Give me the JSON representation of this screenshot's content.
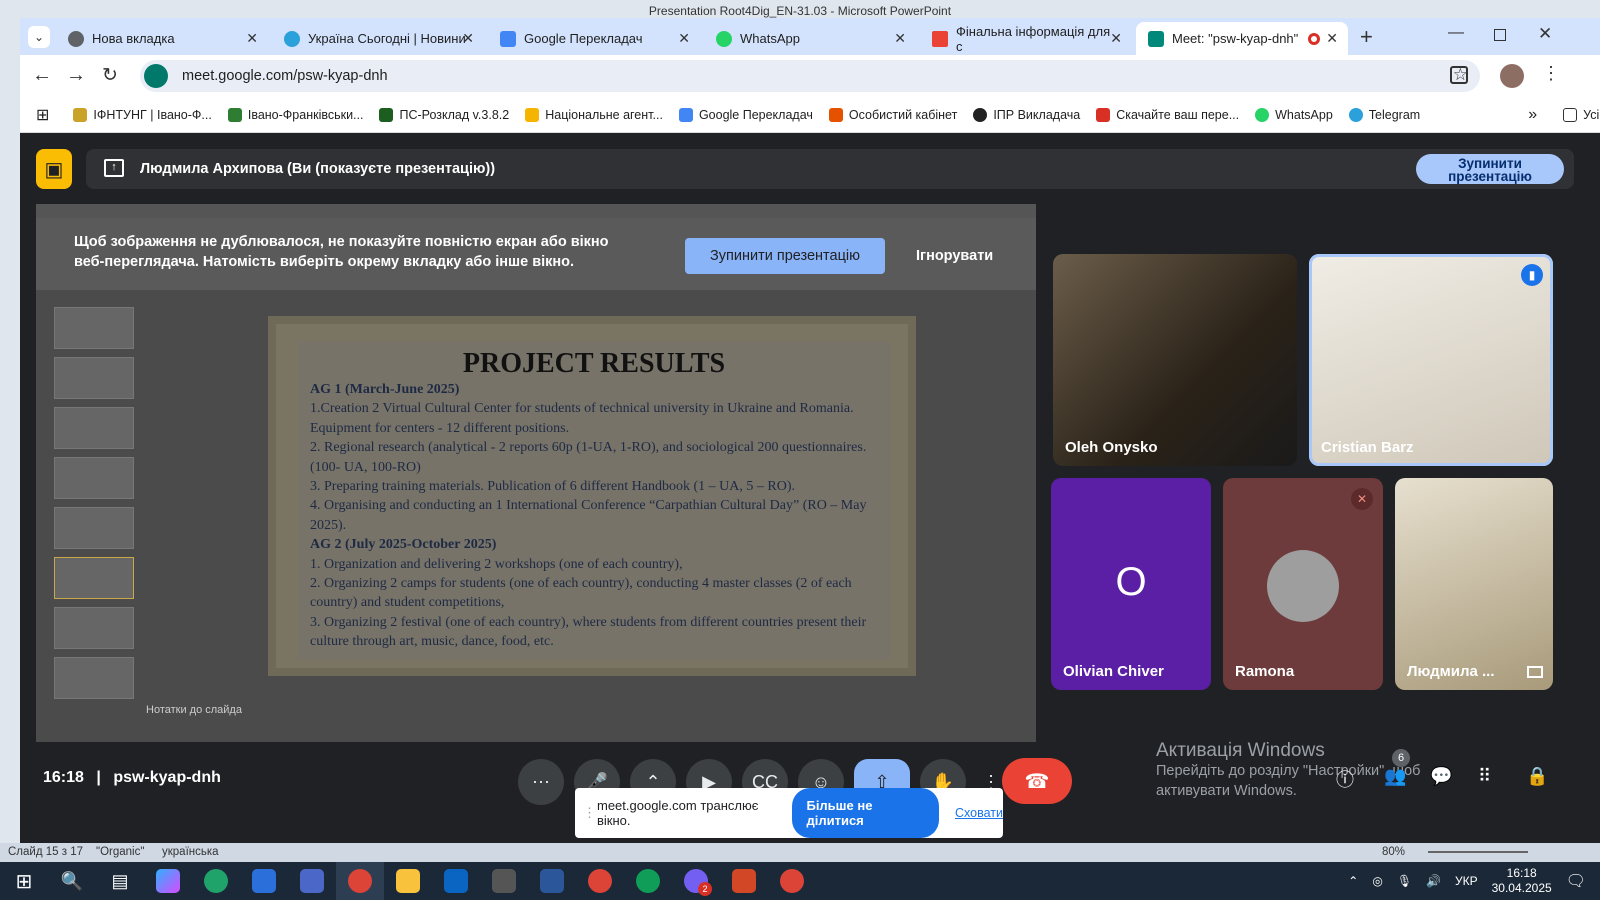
{
  "ppt": {
    "window_title": "Presentation Root4Dig_EN-31.03 - Microsoft PowerPoint",
    "status": {
      "slide": "Слайд 15 з 17",
      "theme": "\"Organic\"",
      "language": "українська",
      "zoom": "80%"
    }
  },
  "browser": {
    "tabs": [
      {
        "label": "Нова вкладка",
        "color": "#5f6368"
      },
      {
        "label": "Україна Сьогодні | Новини",
        "color": "#2aa1da"
      },
      {
        "label": "Google Перекладач",
        "color": "#4285f4"
      },
      {
        "label": "WhatsApp",
        "color": "#25d366"
      },
      {
        "label": "Фінальна інформація для с",
        "color": "#ea4335"
      },
      {
        "label": "Meet: \"psw-kyap-dnh\"",
        "color": "#00897b"
      }
    ],
    "url": "meet.google.com/psw-kyap-dnh",
    "bookmarks": [
      {
        "label": "ІФНТУНГ | Івано-Ф...",
        "color": "#c9a227"
      },
      {
        "label": "Івано-Франківськи...",
        "color": "#2e7d32"
      },
      {
        "label": "ПС-Розклад v.3.8.2",
        "color": "#1b5e20"
      },
      {
        "label": "Національне агент...",
        "color": "#f4b400"
      },
      {
        "label": "Google Перекладач",
        "color": "#4285f4"
      },
      {
        "label": "Особистий кабінет",
        "color": "#e65100"
      },
      {
        "label": "ІПР Викладача",
        "color": "#222222"
      },
      {
        "label": "Скачайте ваш пере...",
        "color": "#d93025"
      },
      {
        "label": "WhatsApp",
        "color": "#25d366"
      },
      {
        "label": "Telegram",
        "color": "#2aa1da"
      }
    ],
    "all_bookmarks": "Усі закладки"
  },
  "meet": {
    "presenter_text": "Людмила Архипова (Ви (показуєте презентацію))",
    "stop_top": "Зупинити презентацію",
    "warning": "Щоб зображення не дублювалося, не показуйте повністю екран або вікно веб-переглядача. Натомість виберіть окрему вкладку або інше вікно.",
    "warning_stop": "Зупинити презентацію",
    "warning_ignore": "Ігнорувати",
    "notes_placeholder": "Нотатки до слайда",
    "slide": {
      "title": "PROJECT RESULTS",
      "lines": [
        {
          "text": "AG 1 (March-June 2025)",
          "bold": true
        },
        {
          "text": "1.Creation 2 Virtual Cultural Center for students of technical university in Ukraine and Romania. Equipment for centers - 12 different positions."
        },
        {
          "text": "2. Regional research (analytical - 2 reports 60p (1-UA, 1-RO), and sociological 200 questionnaires. (100- UA, 100-RO)"
        },
        {
          "text": "3. Preparing training materials. Publication of 6 different Handbook (1 – UA, 5 – RO)."
        },
        {
          "text": "4. Organising and conducting an 1 International Conference “Carpathian Cultural Day” (RO – May 2025)."
        },
        {
          "text": "AG 2 (July 2025-October 2025)",
          "bold": true
        },
        {
          "text": "1.   Organization and delivering 2 workshops (one of each country),"
        },
        {
          "text": "2.   Organizing 2 camps for students (one of each country), conducting 4 master classes (2 of each country) and student competitions,"
        },
        {
          "text": "3.   Organizing 2 festival (one of each country), where students from different countries present their culture through art, music, dance, food, etc."
        }
      ]
    },
    "participants": [
      {
        "name": "Oleh Onysko"
      },
      {
        "name": "Cristian Barz"
      },
      {
        "name": "Olivian Chiver",
        "initial": "O"
      },
      {
        "name": "Ramona"
      },
      {
        "name": "Людмила ..."
      }
    ],
    "time": "16:18",
    "code": "psw-kyap-dnh",
    "people_count": "6",
    "activation": {
      "title": "Активація Windows",
      "body": "Перейдіть до розділу \"Настройки\", щоб активувати Windows."
    },
    "share_notice": {
      "text": "meet.google.com транслює вікно.",
      "stop": "Більше не ділитися",
      "hide": "Сховати"
    }
  },
  "taskbar": {
    "lang": "УКР",
    "time": "16:18",
    "date": "30.04.2025",
    "chrome_badge": "2"
  }
}
